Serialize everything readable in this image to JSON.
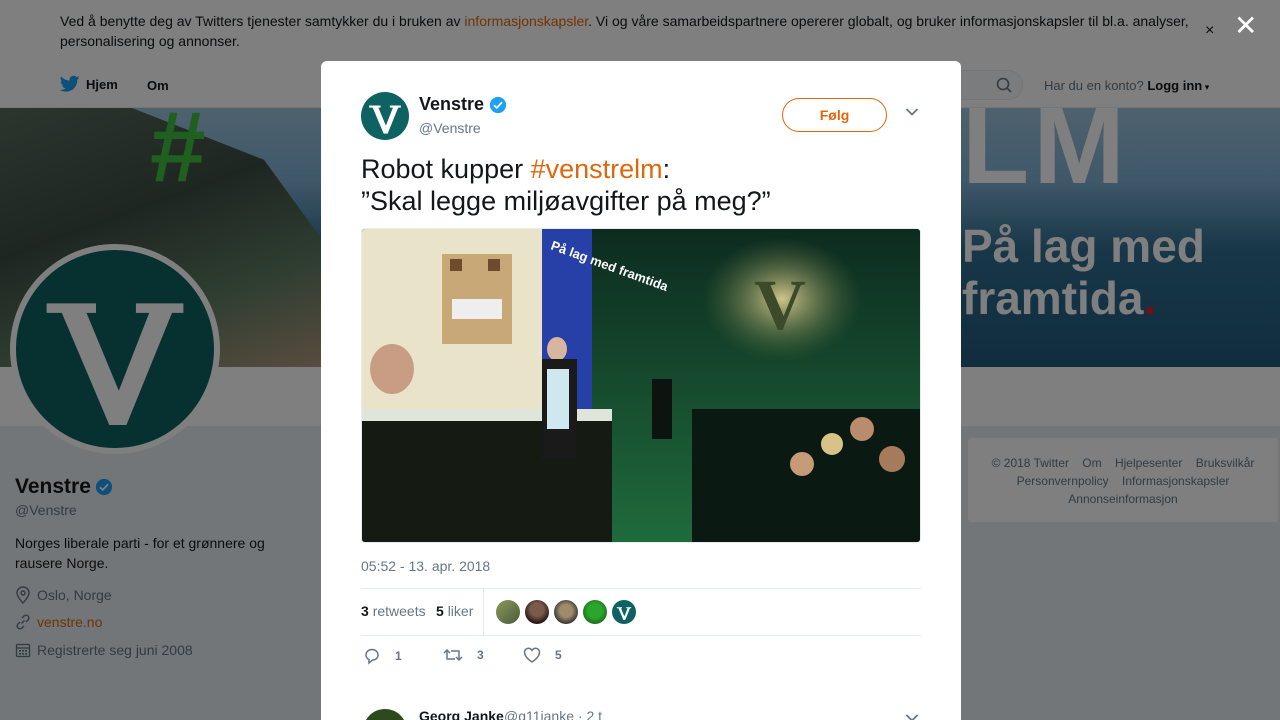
{
  "cookie_banner": {
    "text_before": "Ved å benytte deg av Twitters tjenester samtykker du i bruken av ",
    "link": "informasjonskapsler",
    "text_after": ". Vi og våre samarbeidspartnere opererer globalt, og bruker informasjonskapsler til bl.a. analyser, personalisering og annonser.",
    "close_glyph": "×"
  },
  "topnav": {
    "home": "Hjem",
    "about": "Om",
    "account_question": "Har du en konto?",
    "login": "Logg inn"
  },
  "banner": {
    "hash_text": "#",
    "lm_text": "LM",
    "slogan_line1": "På lag med",
    "slogan_line2": "framtida",
    "slogan_dot": "."
  },
  "profile": {
    "name": "Venstre",
    "handle": "@Venstre",
    "bio": "Norges liberale parti - for et grønnere og rausere Norge.",
    "location": "Oslo, Norge",
    "website": "venstre.no",
    "joined": "Registrerte seg juni 2008",
    "avatar_letter": "V"
  },
  "footer": {
    "links_line1": [
      "© 2018 Twitter",
      "Om",
      "Hjelpesenter",
      "Bruksvilkår"
    ],
    "links_line2": [
      "Personvernpolicy",
      "Informasjonskapsler"
    ],
    "links_line3": [
      "Annonseinformasjon"
    ]
  },
  "overlay": {
    "close_glyph": "✕"
  },
  "tweet": {
    "author_name": "Venstre",
    "author_handle": "@Venstre",
    "follow_label": "Følg",
    "text_line1_before": "Robot kupper ",
    "hashtag": "#venstrelm",
    "text_line1_after": ":",
    "text_line2": "”Skal legge miljøavgifter på meg?”",
    "timestamp": "05:52 - 13. apr. 2018",
    "retweets_count": "3",
    "retweets_label": "retweets",
    "likes_count": "5",
    "likes_label": "liker",
    "reply_count": "1",
    "retweet_count": "3",
    "like_count": "5",
    "media": {
      "sign_text": "På lag med framtida",
      "v_letter": "V"
    }
  },
  "reply": {
    "name": "Georg Janke",
    "handle": "@g11janke · 2 t"
  },
  "colors": {
    "accent": "#e0670b",
    "venstre_green": "#0e6262",
    "twitter_blue": "#1da1f2"
  }
}
